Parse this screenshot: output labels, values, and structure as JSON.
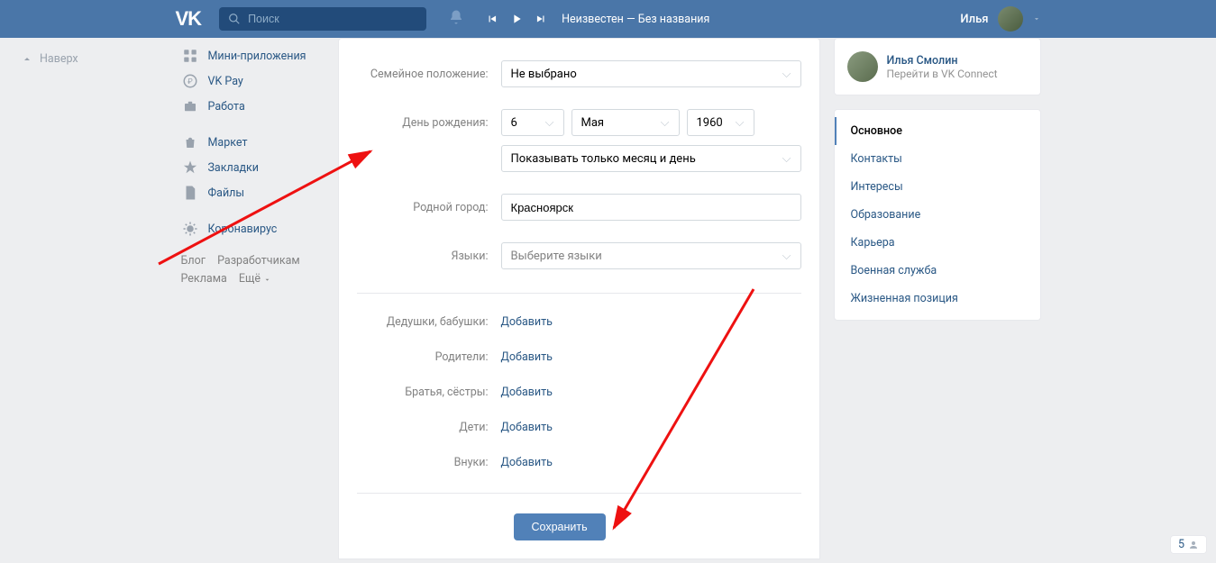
{
  "header": {
    "search_placeholder": "Поиск",
    "track": "Неизвестен — Без названия",
    "username": "Илья"
  },
  "backtop": "Наверх",
  "sidebar": {
    "items": [
      {
        "label": "Мини-приложения",
        "icon": "grid"
      },
      {
        "label": "VK Pay",
        "icon": "ruble"
      },
      {
        "label": "Работа",
        "icon": "briefcase"
      }
    ],
    "items2": [
      {
        "label": "Маркет",
        "icon": "bag"
      },
      {
        "label": "Закладки",
        "icon": "star"
      },
      {
        "label": "Файлы",
        "icon": "doc"
      }
    ],
    "items3": [
      {
        "label": "Коронавирус",
        "icon": "virus"
      }
    ],
    "footer": {
      "blog": "Блог",
      "devs": "Разработчикам",
      "ads": "Реклама",
      "more": "Ещё"
    }
  },
  "form": {
    "marital_label": "Семейное положение:",
    "marital_value": "Не выбрано",
    "birthday_label": "День рождения:",
    "bd_day": "6",
    "bd_month": "Мая",
    "bd_year": "1960",
    "bd_visibility": "Показывать только месяц и день",
    "hometown_label": "Родной город:",
    "hometown_value": "Красноярск",
    "languages_label": "Языки:",
    "languages_placeholder": "Выберите языки",
    "relatives": [
      {
        "label": "Дедушки, бабушки:",
        "action": "Добавить"
      },
      {
        "label": "Родители:",
        "action": "Добавить"
      },
      {
        "label": "Братья, сёстры:",
        "action": "Добавить"
      },
      {
        "label": "Дети:",
        "action": "Добавить"
      },
      {
        "label": "Внуки:",
        "action": "Добавить"
      }
    ],
    "save": "Сохранить"
  },
  "profile": {
    "name": "Илья Смолин",
    "connect": "Перейти в VK Connect"
  },
  "tabs": [
    "Основное",
    "Контакты",
    "Интересы",
    "Образование",
    "Карьера",
    "Военная служба",
    "Жизненная позиция"
  ],
  "counter": "5"
}
